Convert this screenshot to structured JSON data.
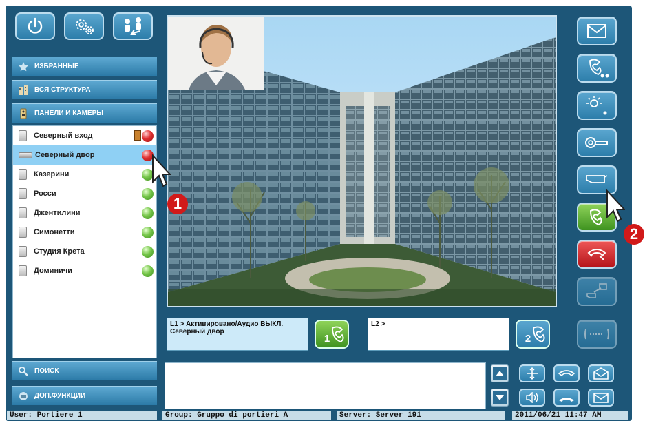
{
  "toolbar": {
    "power_icon": "power-icon",
    "settings_icon": "gears-icon",
    "users_icon": "users-transfer-icon"
  },
  "nav": {
    "favorites": "ИЗБРАННЫЕ",
    "structure": "ВСЯ СТРУКТУРА",
    "panels": "ПАНЕЛИ И КАМЕРЫ",
    "search": "ПОИСК",
    "extra": "ДОП.ФУНКЦИИ"
  },
  "panels": [
    {
      "name": "Северный вход",
      "status": "red",
      "icon": "panel-icon"
    },
    {
      "name": "Северный двор",
      "status": "red",
      "icon": "camera-icon"
    },
    {
      "name": "Казерини",
      "status": "green",
      "icon": "panel-icon"
    },
    {
      "name": "Росси",
      "status": "green",
      "icon": "panel-icon"
    },
    {
      "name": "Джентилини",
      "status": "green",
      "icon": "panel-icon"
    },
    {
      "name": "Симонетти",
      "status": "green",
      "icon": "panel-icon"
    },
    {
      "name": "Студия Крета",
      "status": "green",
      "icon": "panel-icon"
    },
    {
      "name": "Доминичи",
      "status": "green",
      "icon": "panel-icon"
    }
  ],
  "lines": {
    "l1_status": "L1 > Активировано/Аудио ВЫКЛ.",
    "l1_target": "Северный двор",
    "l1_button": "1",
    "l2_status": "L2 >",
    "l2_button": "2"
  },
  "right_buttons": [
    "envelope-icon",
    "call-forward-icon",
    "brightness-icon",
    "key-icon",
    "camera-switch-icon",
    "answer-call-icon",
    "hangup-icon",
    "camera-transfer-icon",
    "intercom-icon"
  ],
  "badges": {
    "one": "1",
    "two": "2"
  },
  "status": {
    "user": "User:  Portiere 1",
    "group": "Group:  Gruppo di portieri A",
    "server": "Server:  Server 191",
    "datetime": "2011/06/21  11:47 AM"
  },
  "colors": {
    "frame": "#1d5678",
    "accent": "#2d7eab",
    "selected_row": "#8fd0f4",
    "status_ok": "#5cb033",
    "status_alarm": "#d42828"
  }
}
